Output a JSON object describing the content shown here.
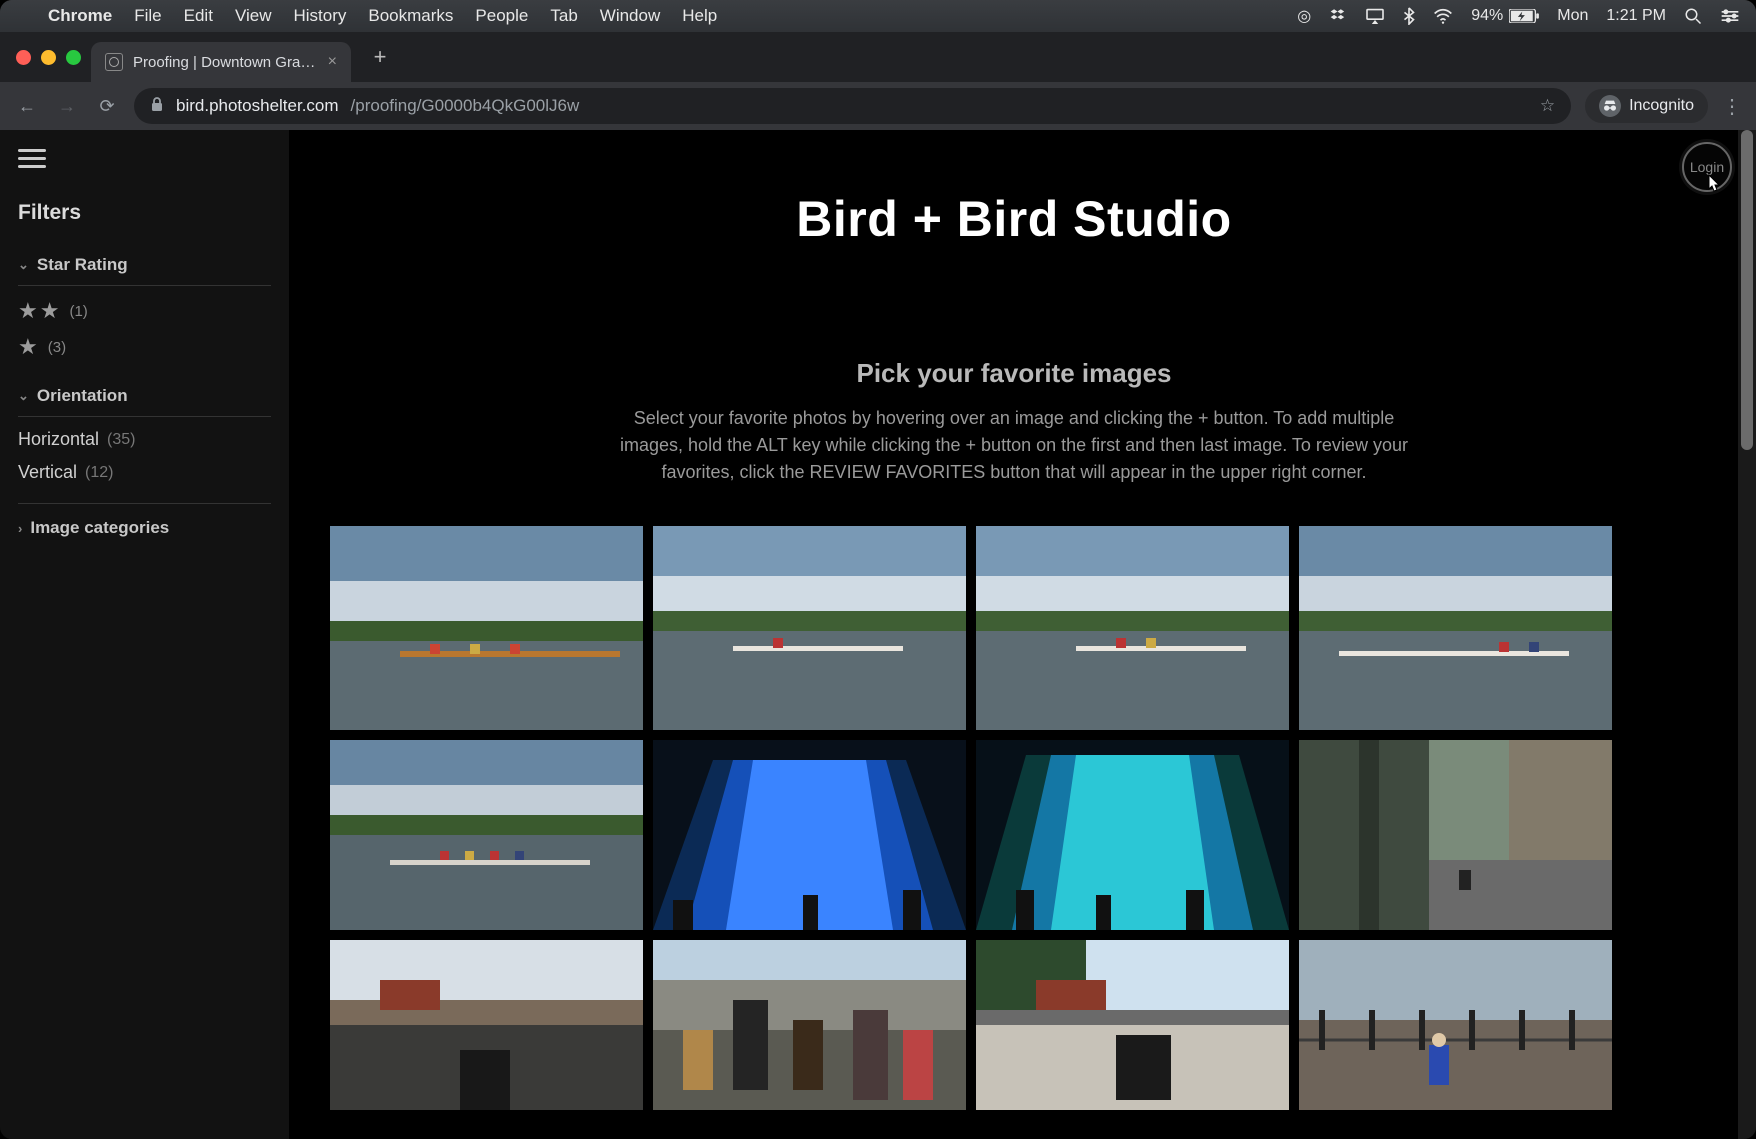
{
  "menubar": {
    "app": "Chrome",
    "items": [
      "File",
      "Edit",
      "View",
      "History",
      "Bookmarks",
      "People",
      "Tab",
      "Window",
      "Help"
    ],
    "battery": "94%",
    "day": "Mon",
    "time": "1:21 PM"
  },
  "chrome": {
    "tab_title": "Proofing | Downtown Grand Ra...",
    "url_host": "bird.photoshelter.com",
    "url_path": "/proofing/G0000b4QkG00lJ6w",
    "incognito_label": "Incognito"
  },
  "page": {
    "studio_title": "Bird + Bird Studio",
    "heading": "Pick your favorite images",
    "instructions": "Select your favorite photos by hovering over an image and clicking the + button. To add multiple images, hold the ALT key while clicking the + button on the first and then last image. To review your favorites, click the REVIEW FAVORITES button that will appear in the upper right corner.",
    "login_label": "Login"
  },
  "sidebar": {
    "filters_label": "Filters",
    "groups": {
      "star": {
        "label": "Star Rating",
        "rows": [
          {
            "stars": 2,
            "count": "(1)"
          },
          {
            "stars": 1,
            "count": "(3)"
          }
        ]
      },
      "orientation": {
        "label": "Orientation",
        "rows": [
          {
            "label": "Horizontal",
            "count": "(35)"
          },
          {
            "label": "Vertical",
            "count": "(12)"
          }
        ]
      },
      "categories": {
        "label": "Image categories"
      }
    }
  }
}
